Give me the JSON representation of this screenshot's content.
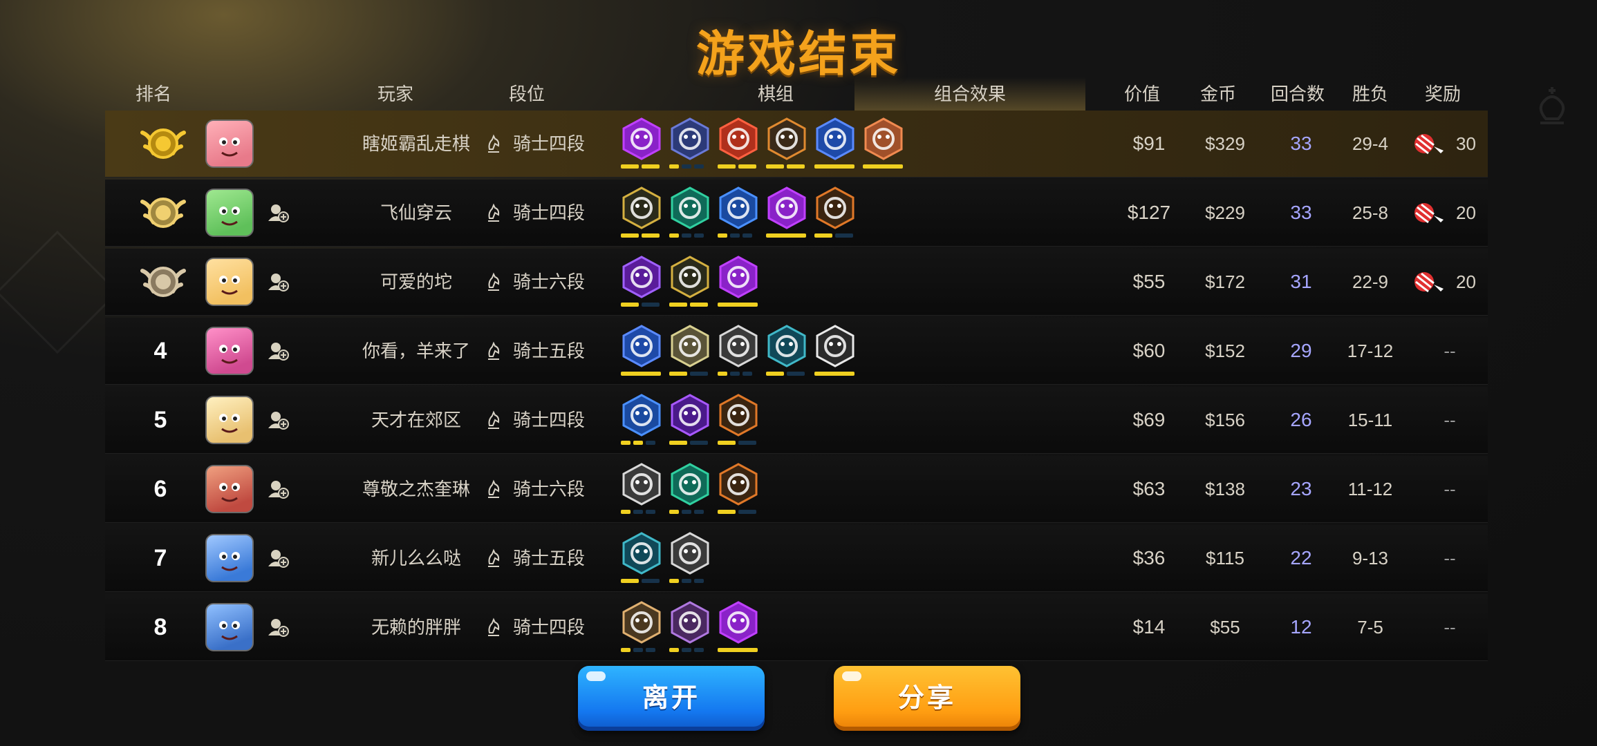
{
  "title": "游戏结束",
  "headers": {
    "rank": "排名",
    "player": "玩家",
    "tier": "段位",
    "pieces": "棋组",
    "synergy": "组合效果",
    "value": "价值",
    "gold": "金币",
    "rounds": "回合数",
    "record": "胜负",
    "reward": "奖励"
  },
  "active_tab": "synergy",
  "rows": [
    {
      "rank": "1",
      "name": "瞎姬霸乱走棋",
      "tier": "骑士四段",
      "value": "$91",
      "gold": "$329",
      "rounds": "33",
      "record": "29-4",
      "reward": "30",
      "friend_icon": false,
      "traits": [
        "demon-purple",
        "mech-slate",
        "orc-red",
        "gear-orange",
        "glacier-blue",
        "dwarf-orange"
      ]
    },
    {
      "rank": "2",
      "name": "飞仙穿云",
      "tier": "骑士四段",
      "value": "$127",
      "gold": "$229",
      "rounds": "33",
      "record": "25-8",
      "reward": "20",
      "friend_icon": true,
      "traits": [
        "assassin-gold",
        "beast-teal",
        "feather-blue",
        "demon-purple",
        "leaf-orange"
      ]
    },
    {
      "rank": "3",
      "name": "可爱的坨",
      "tier": "骑士六段",
      "value": "$55",
      "gold": "$172",
      "rounds": "31",
      "record": "22-9",
      "reward": "20",
      "friend_icon": true,
      "traits": [
        "fish-purple",
        "assassin-gold",
        "demon-purple"
      ]
    },
    {
      "rank": "4",
      "name": "你看，羊来了",
      "tier": "骑士五段",
      "value": "$60",
      "gold": "$152",
      "rounds": "29",
      "record": "17-12",
      "reward": "--",
      "friend_icon": true,
      "traits": [
        "glacier-blue",
        "goblin-tan",
        "knight-gray",
        "mage-teal",
        "priest-gray"
      ]
    },
    {
      "rank": "5",
      "name": "天才在郊区",
      "tier": "骑士四段",
      "value": "$69",
      "gold": "$156",
      "rounds": "26",
      "record": "15-11",
      "reward": "--",
      "friend_icon": true,
      "traits": [
        "feather-blue",
        "elf-purple",
        "leaf-orange"
      ]
    },
    {
      "rank": "6",
      "name": "尊敬之杰奎琳",
      "tier": "骑士六段",
      "value": "$63",
      "gold": "$138",
      "rounds": "23",
      "record": "11-12",
      "reward": "--",
      "friend_icon": true,
      "traits": [
        "knight-gray",
        "beast-teal",
        "leaf-orange"
      ]
    },
    {
      "rank": "7",
      "name": "新儿么么哒",
      "tier": "骑士五段",
      "value": "$36",
      "gold": "$115",
      "rounds": "22",
      "record": "9-13",
      "reward": "--",
      "friend_icon": true,
      "traits": [
        "mage-teal",
        "knight-gray"
      ]
    },
    {
      "rank": "8",
      "name": "无赖的胖胖",
      "tier": "骑士四段",
      "value": "$14",
      "gold": "$55",
      "rounds": "12",
      "record": "7-5",
      "reward": "--",
      "friend_icon": true,
      "traits": [
        "warrior-tan",
        "horse-purple",
        "demon-purple"
      ]
    }
  ],
  "buttons": {
    "leave": "离开",
    "share": "分享"
  },
  "colors": {
    "title": "#f4a21c",
    "rounds": "#a6a6ff",
    "bar_on": "#f0d020",
    "bar_off": "#17324a",
    "leave": "#1478f0",
    "share": "#ff9e12"
  }
}
